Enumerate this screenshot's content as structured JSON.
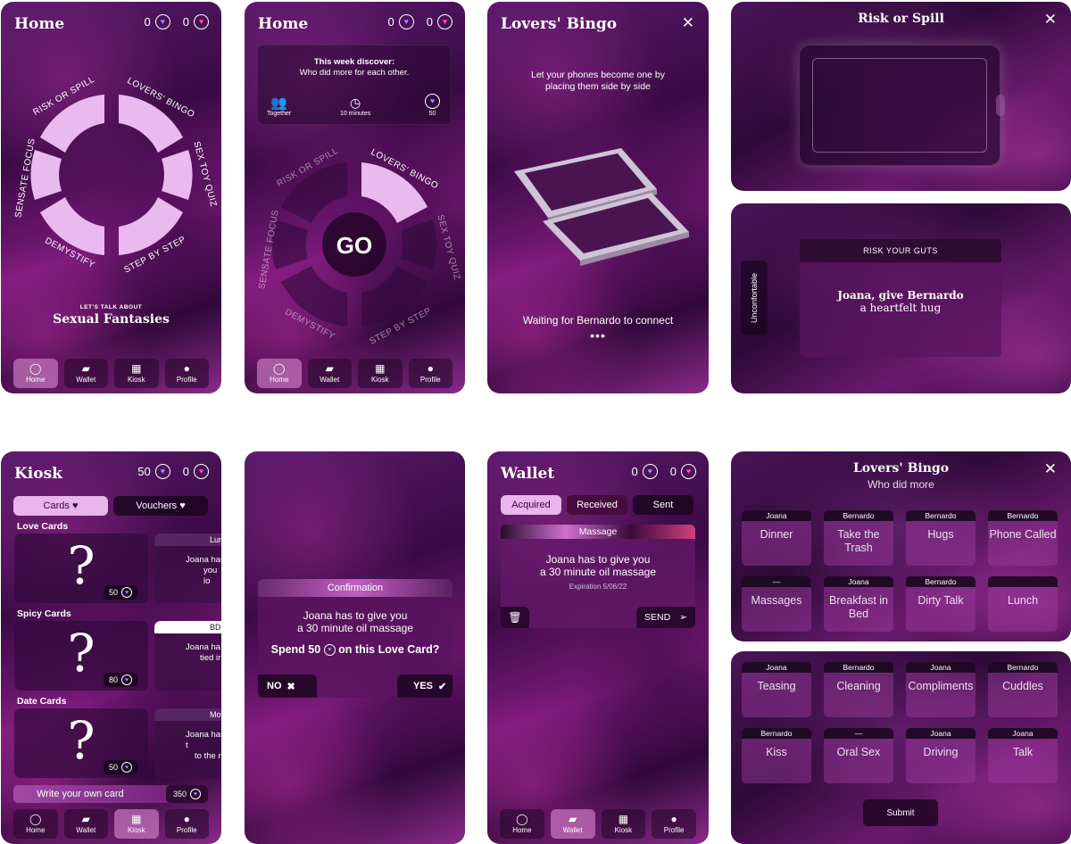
{
  "home1": {
    "title": "Home",
    "gems": "0",
    "hearts": "0",
    "labels": [
      "RISK OR SPILL",
      "LOVERS' BINGO",
      "SEX TOY QUIZ",
      "STEP BY STEP",
      "DEMYSTIFY",
      "SENSATE FOCUS"
    ],
    "kicker": "LET'S TALK ABOUT",
    "topic": "Sexual Fantasies"
  },
  "home2": {
    "title": "Home",
    "gems": "0",
    "hearts": "0",
    "discover_l1": "This week discover:",
    "discover_l2": "Who did more for each other.",
    "together": "Together",
    "minutes": "10 minutes",
    "points": "50",
    "go": "GO",
    "labels": [
      "RISK OR SPILL",
      "LOVERS' BINGO",
      "SEX TOY QUIZ",
      "STEP BY STEP",
      "DEMYSTIFY",
      "SENSATE FOCUS"
    ]
  },
  "nav": {
    "home": "Home",
    "wallet": "Wallet",
    "kiosk": "Kiosk",
    "profile": "Profile"
  },
  "connect": {
    "title": "Lovers' Bingo",
    "instr_l1": "Let your phones become one by",
    "instr_l2": "placing them side by side",
    "waiting": "Waiting for Bernardo to connect",
    "dots": "•••"
  },
  "risk_top": {
    "title": "Risk or Spill"
  },
  "risk_bottom": {
    "side": "Unconfortable",
    "header": "RISK YOUR GUTS",
    "line1": "Joana, give Bernardo",
    "line2": "a heartfelt hug"
  },
  "kiosk": {
    "title": "Kiosk",
    "gems": "50",
    "hearts": "0",
    "tab_cards": "Cards",
    "tab_vouchers": "Vouchers",
    "love": "Love Cards",
    "spicy": "Spicy Cards",
    "date": "Date Cards",
    "q": "?",
    "p_love": "50",
    "p_spicy": "80",
    "p_date": "50",
    "peek_love_tag": "Lur",
    "peek_love_txt_l1": "Joana has",
    "peek_love_txt_l2": "you lo",
    "peek_spicy_tag": "BDS",
    "peek_spicy_txt_l1": "Joana ha",
    "peek_spicy_txt_l2": "tied ir",
    "peek_date_tag": "Mov",
    "peek_date_txt_l1": "Joana has t",
    "peek_date_txt_l2": "to the n",
    "write": "Write your own card",
    "write_price": "350"
  },
  "confirm": {
    "header": "Confirmation",
    "l1": "Joana has to give you",
    "l2": "a 30 minute oil massage",
    "spend_pre": "Spend",
    "spend_val": "50",
    "spend_post": "on this Love Card?",
    "no": "NO",
    "yes": "YES"
  },
  "wallet": {
    "title": "Wallet",
    "gems": "0",
    "hearts": "0",
    "tab_acq": "Acquired",
    "tab_rec": "Received",
    "tab_sent": "Sent",
    "card_title": "Massage",
    "l1": "Joana has to give you",
    "l2": "a 30 minute oil massage",
    "exp": "Expiration 5/06/22",
    "send": "SEND"
  },
  "bingo": {
    "title": "Lovers' Bingo",
    "subtitle": "Who did more",
    "submit": "Submit",
    "grid1": [
      {
        "tag": "Joana",
        "word": "Dinner"
      },
      {
        "tag": "Bernardo",
        "word": "Take the Trash"
      },
      {
        "tag": "Bernardo",
        "word": "Hugs"
      },
      {
        "tag": "Bernardo",
        "word": "Phone Called"
      },
      {
        "tag": "—",
        "word": "Massages"
      },
      {
        "tag": "Joana",
        "word": "Breakfast in Bed"
      },
      {
        "tag": "Bernardo",
        "word": "Dirty Talk"
      },
      {
        "tag": "",
        "word": "Lunch"
      }
    ],
    "grid2": [
      {
        "tag": "Joana",
        "word": "Teasing"
      },
      {
        "tag": "Bernardo",
        "word": "Cleaning"
      },
      {
        "tag": "Joana",
        "word": "Compliments"
      },
      {
        "tag": "Bernardo",
        "word": "Cuddles"
      },
      {
        "tag": "Bernardo",
        "word": "Kiss"
      },
      {
        "tag": "—",
        "word": "Oral Sex"
      },
      {
        "tag": "Joana",
        "word": "Driving"
      },
      {
        "tag": "Joana",
        "word": "Talk"
      }
    ]
  },
  "colors": {
    "wedge": "#eab9ef",
    "gem": "#9a8cff",
    "heart": "#ff4fa8"
  }
}
